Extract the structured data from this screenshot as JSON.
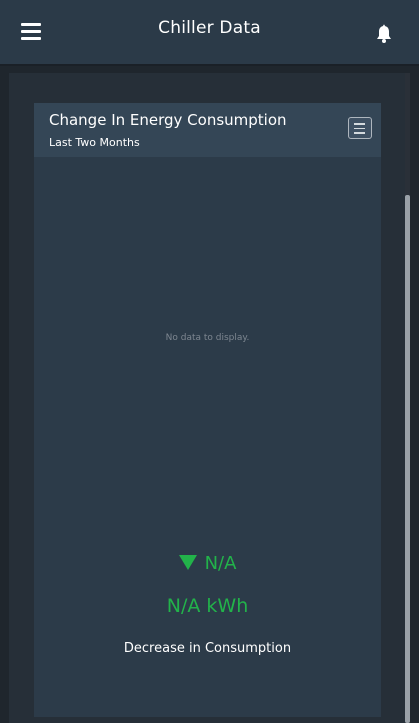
{
  "header": {
    "title": "Chiller Data",
    "menu_icon": "hamburger-menu-icon",
    "notification_icon": "bell-icon"
  },
  "card": {
    "title": "Change In Energy Consumption",
    "subtitle": "Last Two Months",
    "menu_icon": "chart-menu-icon",
    "no_data": "No data to display.",
    "change_value": "N/A",
    "kwh_value": "N/A kWh",
    "caption": "Decrease in Consumption"
  },
  "colors": {
    "topbar": "#2b3a48",
    "card": "#2c3b49",
    "card_header": "#344656",
    "accent_green": "#22b34a"
  }
}
